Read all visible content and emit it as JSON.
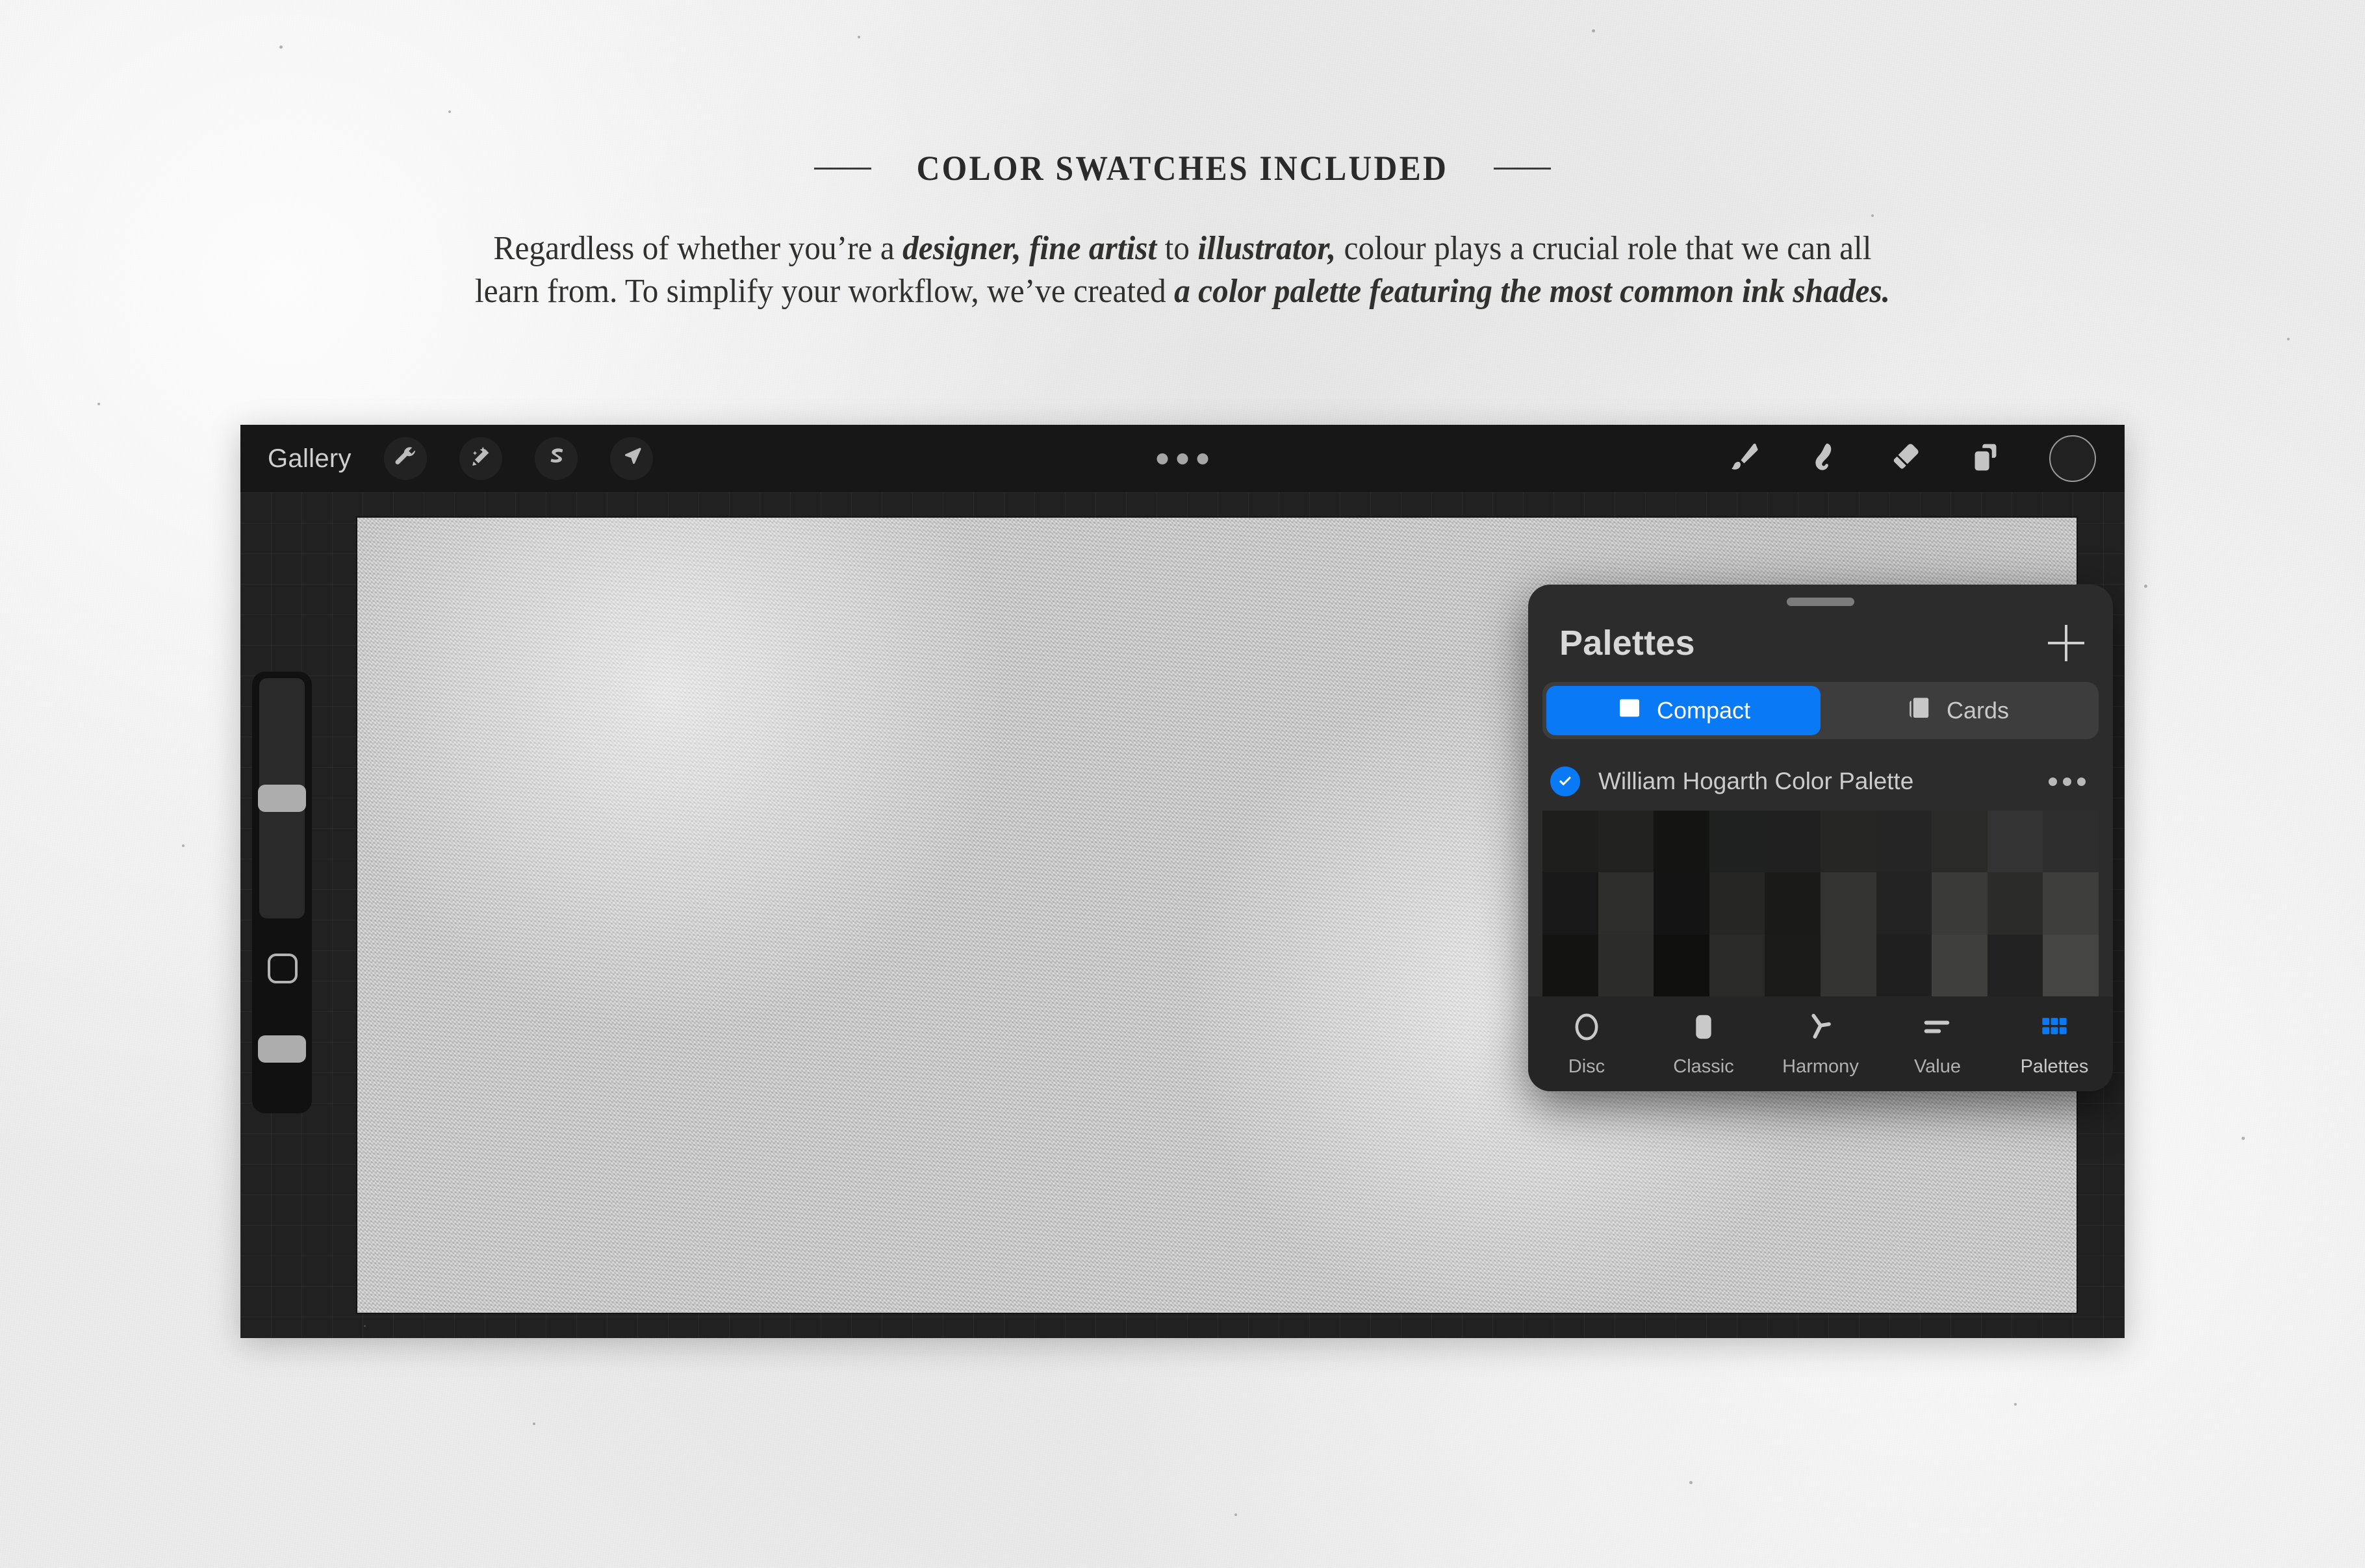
{
  "header": {
    "eyebrow": "COLOR SWATCHES INCLUDED",
    "paragraph": {
      "part1": "Regardless of whether you’re a ",
      "em1": "designer, fine artist",
      "part2": " to ",
      "em2": "illustrator,",
      "part3": " colour plays a crucial role that we can all learn from. To simplify your workflow, we’ve created ",
      "em3": "a color palette featuring the most common ink shades."
    }
  },
  "app": {
    "toolbar": {
      "gallery_label": "Gallery",
      "left_tools": [
        {
          "name": "wrench-icon",
          "label": "Actions"
        },
        {
          "name": "magic-wand-icon",
          "label": "Adjustments"
        },
        {
          "name": "selection-icon",
          "label": "Selection"
        },
        {
          "name": "transform-arrow-icon",
          "label": "Transform"
        }
      ],
      "overflow_label": "More options",
      "right_tools": [
        {
          "name": "paintbrush-icon",
          "label": "Paint"
        },
        {
          "name": "smudge-icon",
          "label": "Smudge"
        },
        {
          "name": "eraser-icon",
          "label": "Erase"
        },
        {
          "name": "layers-icon",
          "label": "Layers"
        }
      ],
      "color_puck": {
        "name": "color-puck",
        "label": "Color",
        "color": "#212121"
      }
    },
    "sidebar": {
      "brush_size_label": "Brush size",
      "modify_label": "Modify",
      "opacity_label": "Opacity"
    }
  },
  "panel": {
    "title": "Palettes",
    "add_label": "+",
    "view_modes": [
      {
        "label": "Compact",
        "icon": "compact-view-icon",
        "active": true
      },
      {
        "label": "Cards",
        "icon": "cards-view-icon",
        "active": false
      }
    ],
    "palette": {
      "name": "William Hogarth Color Palette",
      "selected": true,
      "more_label": "More"
    },
    "accent_color": "#0a79f5",
    "swatches": [
      "#1e1e1c",
      "#222221",
      "#141413",
      "#1f2020",
      "#202020",
      "#262625",
      "#252525",
      "#2a2a29",
      "#333333",
      "#2e2e2e",
      "#181818",
      "#2e2e2d",
      "#141414",
      "#262625",
      "#1a1a19",
      "#333332",
      "#232323",
      "#3a3a39",
      "#2b2b2a",
      "#3e3e3d",
      "#131312",
      "#2c2c2b",
      "#0f0f0d",
      "#2a2a29",
      "#1b1b1a",
      "#343433",
      "#1f1f1f",
      "#3f3f3e",
      "#222222",
      "#454544"
    ],
    "tabs": [
      {
        "label": "Disc",
        "icon": "disc-icon",
        "active": false
      },
      {
        "label": "Classic",
        "icon": "classic-icon",
        "active": false
      },
      {
        "label": "Harmony",
        "icon": "harmony-icon",
        "active": false
      },
      {
        "label": "Value",
        "icon": "value-icon",
        "active": false
      },
      {
        "label": "Palettes",
        "icon": "palettes-grid-icon",
        "active": true
      }
    ]
  }
}
